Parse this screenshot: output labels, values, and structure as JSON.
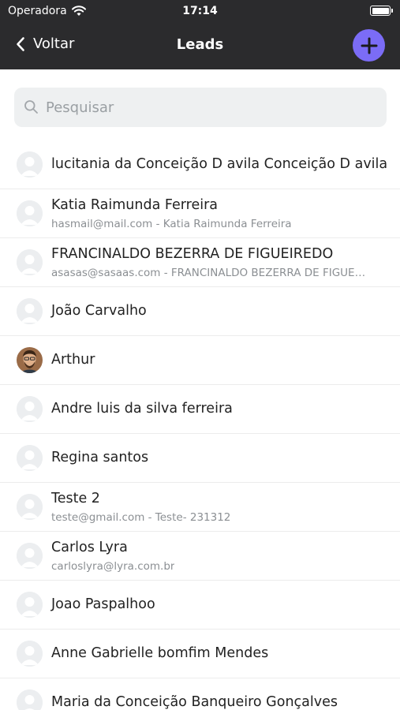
{
  "status_bar": {
    "carrier": "Operadora",
    "time": "17:14"
  },
  "nav": {
    "back_label": "Voltar",
    "title": "Leads"
  },
  "search": {
    "placeholder": "Pesquisar"
  },
  "leads": [
    {
      "name": "lucitania da Conceição D avila Conceição D avila",
      "subtitle": ""
    },
    {
      "name": "Katia Raimunda Ferreira",
      "subtitle": "hasmail@mail.com - Katia Raimunda Ferreira"
    },
    {
      "name": "FRANCINALDO BEZERRA DE FIGUEIREDO",
      "subtitle": "asasas@sasaas.com - FRANCINALDO BEZERRA DE FIGUEI..."
    },
    {
      "name": "João Carvalho",
      "subtitle": ""
    },
    {
      "name": "Arthur",
      "subtitle": ""
    },
    {
      "name": "Andre luis da silva ferreira",
      "subtitle": ""
    },
    {
      "name": "Regina santos",
      "subtitle": ""
    },
    {
      "name": "Teste 2",
      "subtitle": "teste@gmail.com - Teste- 231312"
    },
    {
      "name": "Carlos Lyra",
      "subtitle": "carloslyra@lyra.com.br"
    },
    {
      "name": "Joao Paspalhoo",
      "subtitle": ""
    },
    {
      "name": "Anne Gabrielle bomfim Mendes",
      "subtitle": ""
    },
    {
      "name": "Maria da Conceição Banqueiro Gonçalves",
      "subtitle": ""
    }
  ],
  "colors": {
    "nav_background": "#2b2b2d",
    "accent": "#7b6cf6",
    "search_background": "#eef0f1"
  },
  "icons": {
    "back": "chevron-left-icon",
    "add": "plus-icon",
    "search": "search-icon",
    "avatar": "user-avatar-icon"
  }
}
